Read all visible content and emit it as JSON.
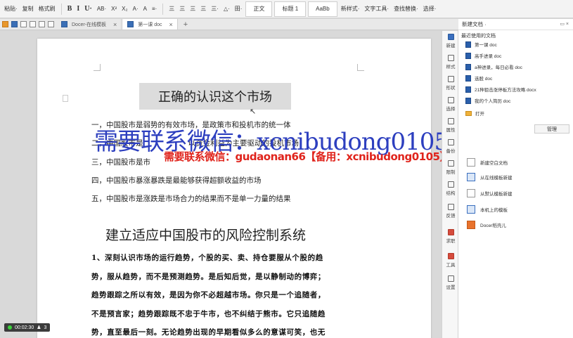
{
  "ribbon": {
    "items": [
      "粘贴·",
      "复制",
      "格式刷",
      "B",
      "I",
      "U·",
      "AB·",
      "X²",
      "X₂",
      "A·",
      "A",
      "≡·",
      "三",
      "三",
      "三",
      "三",
      "三·",
      "△·",
      "田·"
    ],
    "styles": [
      "正文",
      "标题 1",
      "AaBb"
    ],
    "right_items": [
      "新样式·",
      "文字工具·",
      "查找替换·",
      "选择·"
    ]
  },
  "tabs": [
    {
      "label": "Docer-在线模板",
      "active": false
    },
    {
      "label": "第一课 doc",
      "active": true
    }
  ],
  "document": {
    "heading1": "正确的认识这个市场",
    "lines": [
      "一，中国股市是弱势的有效市场，是政策市和投机市的统一体",
      "二，中国股市是",
      "三，中国股市是市",
      "四，中国股市暴涨暴跌是最能够获得超额收益的市场",
      "五，中国股市是涨跌是市场合力的结果而不是单一力量的结果"
    ],
    "hidden_suffix": "以资金利益为主要驱动的投机市场",
    "heading2": "建立适应中国股市的风险控制系统",
    "paragraph": [
      "1、深刻认识市场的运行趋势，个股的买、卖、持仓要服从个股的趋",
      "势，服从趋势，而不是预测趋势。是后知后觉，是以静制动的博弈；",
      "趋势跟踪之所以有效，是因为你不必超越市场。你只是一个追随者，",
      "不是预言家；趋势跟踪既不忠于牛市，也不纠结于熊市。它只追随趋",
      "势，直至最后一刻。无论趋势出现的早期看似多么的意谋可笑，也无"
    ]
  },
  "watermark": {
    "big": "需要联系微信：xcnibudong0105",
    "small": "需要联系微信：gudaonan66【备用：xcnibudong0105】"
  },
  "status": {
    "time": "00:02:30",
    "count": "3"
  },
  "right_tools": [
    "新建",
    "样式",
    "形状",
    "选择",
    "属性",
    "备份",
    "限制",
    "结构",
    "反馈",
    "求职",
    "工具",
    "设置"
  ],
  "panel": {
    "title": "新建文档 ·",
    "recent_label": "最近使用的文档",
    "recent": [
      "第一课 doc",
      "高手进录 doc",
      "a神进录，每日必看 doc",
      "选股 doc",
      "21种狙击涨停板方法攻略 docx",
      "我的个人简历 doc"
    ],
    "open_label": "打开",
    "manage_label": "管理",
    "new_items": [
      "新建空白文档",
      "从在线模板新建",
      "从默认模板新建",
      "本机上的模板",
      "Docer稻壳儿"
    ]
  }
}
